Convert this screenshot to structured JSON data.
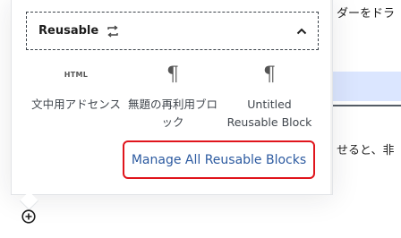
{
  "background": {
    "text_top": "ダーをドラ",
    "text_mid": "せると、非"
  },
  "inserter": {
    "section_title": "Reusable",
    "blocks": [
      {
        "icon": "HTML",
        "label": "文中用アドセンス"
      },
      {
        "icon": "¶",
        "label": "無題の再利用ブロック"
      },
      {
        "icon": "¶",
        "label": "Untitled Reusable Block"
      }
    ],
    "manage_link": "Manage All Reusable Blocks"
  },
  "colors": {
    "link": "#2c5aa0",
    "highlight_border": "#e0151c",
    "selection_bg": "#dbe6ff"
  }
}
